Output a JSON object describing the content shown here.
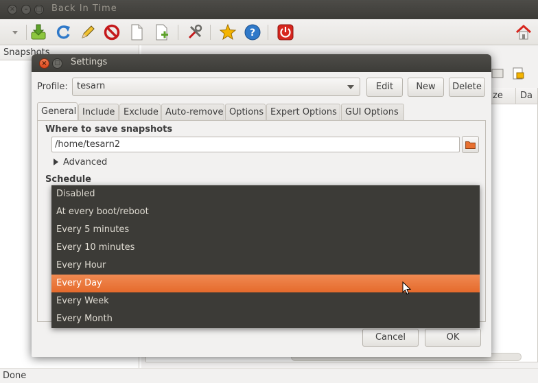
{
  "window": {
    "title": "Back In Time"
  },
  "left_pane": {
    "header": "Snapshots"
  },
  "right_pane": {
    "col_size": "ze",
    "col_date": "Da"
  },
  "status": {
    "text": "Done"
  },
  "toolbar": {
    "icons": [
      "take-snapshot-icon",
      "refresh-icon",
      "edit-icon",
      "stop-icon",
      "new-file-icon",
      "add-file-icon",
      "settings-icon",
      "star-icon",
      "help-icon",
      "shutdown-icon",
      "home-icon"
    ]
  },
  "dialog": {
    "title": "Settings",
    "profile_label": "Profile:",
    "profile_value": "tesarn",
    "edit_button": "Edit",
    "new_button": "New",
    "delete_button": "Delete",
    "tabs": [
      "General",
      "Include",
      "Exclude",
      "Auto-remove",
      "Options",
      "Expert Options",
      "GUI Options"
    ],
    "active_tab": "General",
    "where_label": "Where to save snapshots",
    "where_value": "/home/tesarn2",
    "advanced_label": "Advanced",
    "schedule_label": "Schedule",
    "cancel_button": "Cancel",
    "ok_button": "OK"
  },
  "schedule_dropdown": {
    "options": [
      "Disabled",
      "At every boot/reboot",
      "Every 5 minutes",
      "Every 10 minutes",
      "Every Hour",
      "Every Day",
      "Every Week",
      "Every Month"
    ],
    "selected": "Every Day"
  },
  "colors": {
    "accent": "#e8702f",
    "dark": "#3c3b37"
  }
}
